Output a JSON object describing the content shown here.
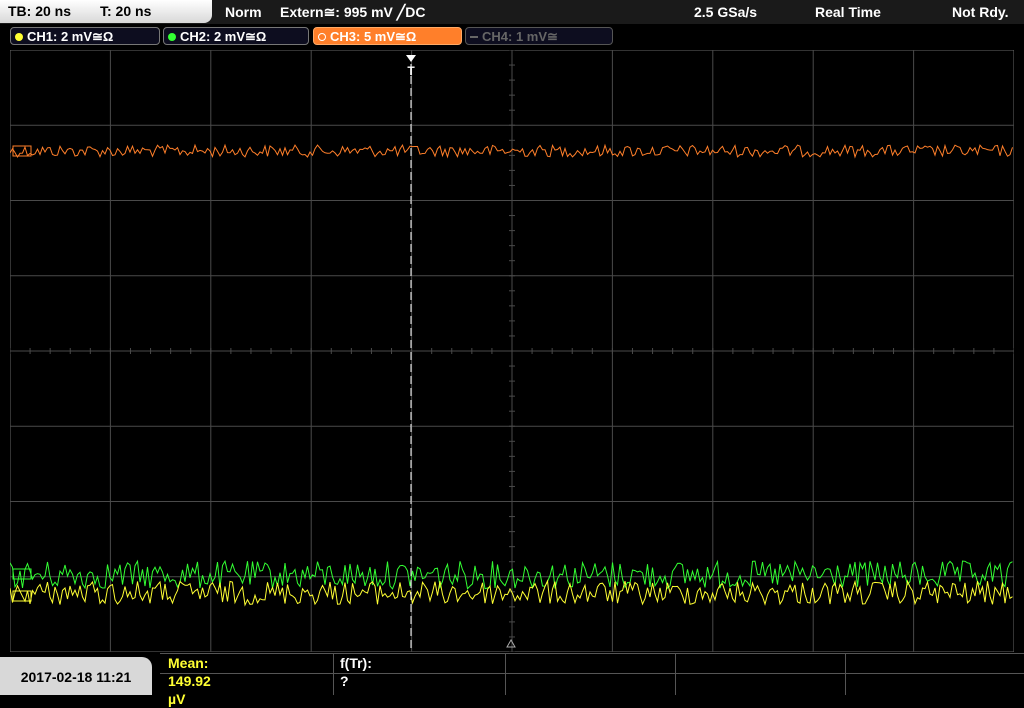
{
  "topbar": {
    "timebase": "TB: 20 ns",
    "trigger_time": "T: 20 ns",
    "mode": "Norm",
    "trigger_source": "Extern≅: 995 mV ╱DC",
    "sample_rate": "2.5 GSa/s",
    "acq_mode": "Real Time",
    "status": "Not Rdy."
  },
  "channels": [
    {
      "label": "CH1: 2 mV≅Ω",
      "color": "#ffff33",
      "state": "on"
    },
    {
      "label": "CH2: 2 mV≅Ω",
      "color": "#33ff33",
      "state": "on"
    },
    {
      "label": "CH3: 5 mV≅Ω",
      "color": "#ff7f2a",
      "state": "active"
    },
    {
      "label": "CH4: 1 mV≅",
      "color": "#888888",
      "state": "off"
    }
  ],
  "trigger_marker": "T",
  "footer": {
    "datetime": "2017-02-18 11:21",
    "mean": "Mean: 149.92 µV",
    "ftr": "f(Tr): ?"
  },
  "colors": {
    "ch1": "#ffff33",
    "ch2": "#33ff33",
    "ch3": "#ff7f2a",
    "grid": "#4a4a4a",
    "trigger_line": "#ffffff"
  }
}
